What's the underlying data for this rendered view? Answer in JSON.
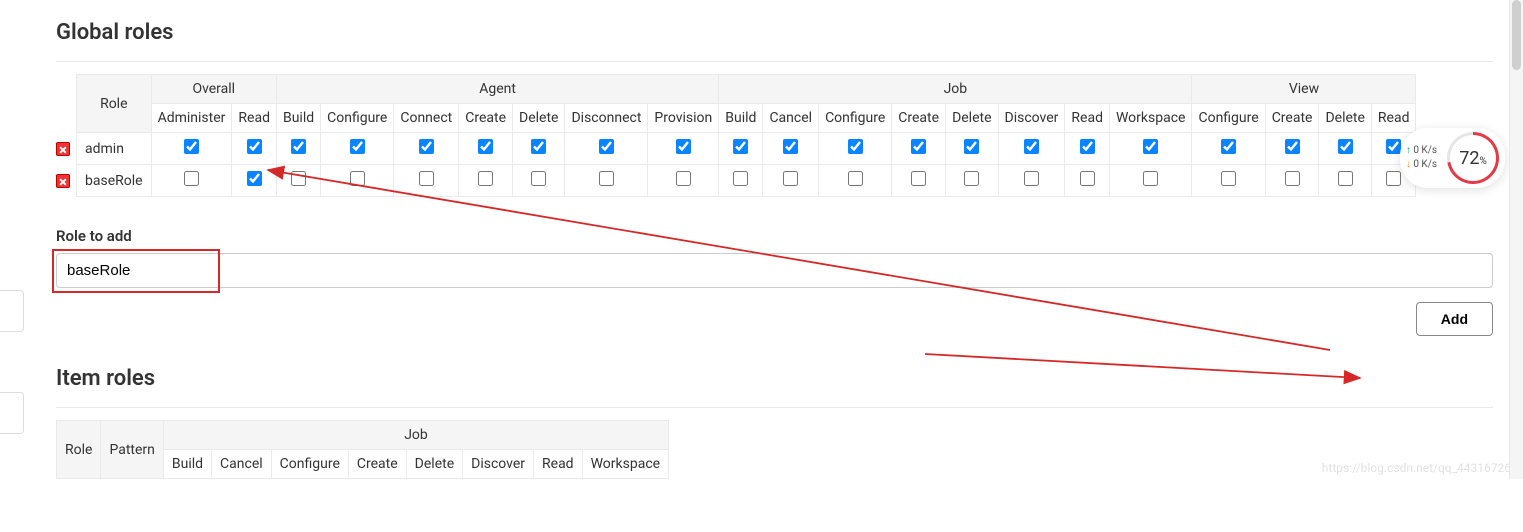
{
  "sections": {
    "global_roles_title": "Global roles",
    "role_to_add_label": "Role to add",
    "item_roles_title": "Item roles"
  },
  "global_roles": {
    "role_header": "Role",
    "groups": [
      {
        "name": "Overall",
        "perms": [
          "Administer",
          "Read"
        ]
      },
      {
        "name": "Agent",
        "perms": [
          "Build",
          "Configure",
          "Connect",
          "Create",
          "Delete",
          "Disconnect",
          "Provision"
        ]
      },
      {
        "name": "Job",
        "perms": [
          "Build",
          "Cancel",
          "Configure",
          "Create",
          "Delete",
          "Discover",
          "Read",
          "Workspace"
        ]
      },
      {
        "name": "View",
        "perms": [
          "Configure",
          "Create",
          "Delete",
          "Read"
        ]
      }
    ],
    "rows": [
      {
        "role": "admin",
        "checked": [
          true,
          true,
          true,
          true,
          true,
          true,
          true,
          true,
          true,
          true,
          true,
          true,
          true,
          true,
          true,
          true,
          true,
          true,
          true,
          true,
          true
        ]
      },
      {
        "role": "baseRole",
        "checked": [
          false,
          true,
          false,
          false,
          false,
          false,
          false,
          false,
          false,
          false,
          false,
          false,
          false,
          false,
          false,
          false,
          false,
          false,
          false,
          false,
          false
        ]
      }
    ]
  },
  "role_to_add": {
    "value": "baseRole",
    "add_button": "Add"
  },
  "item_roles": {
    "role_header": "Role",
    "pattern_header": "Pattern",
    "groups": [
      {
        "name": "Job",
        "perms": [
          "Build",
          "Cancel",
          "Configure",
          "Create",
          "Delete",
          "Discover",
          "Read",
          "Workspace"
        ]
      }
    ]
  },
  "widget": {
    "up": "0  K/s",
    "down": "0  K/s",
    "percent": "72",
    "percent_suffix": "%"
  },
  "watermark": "https://blog.csdn.net/qq_44316726"
}
